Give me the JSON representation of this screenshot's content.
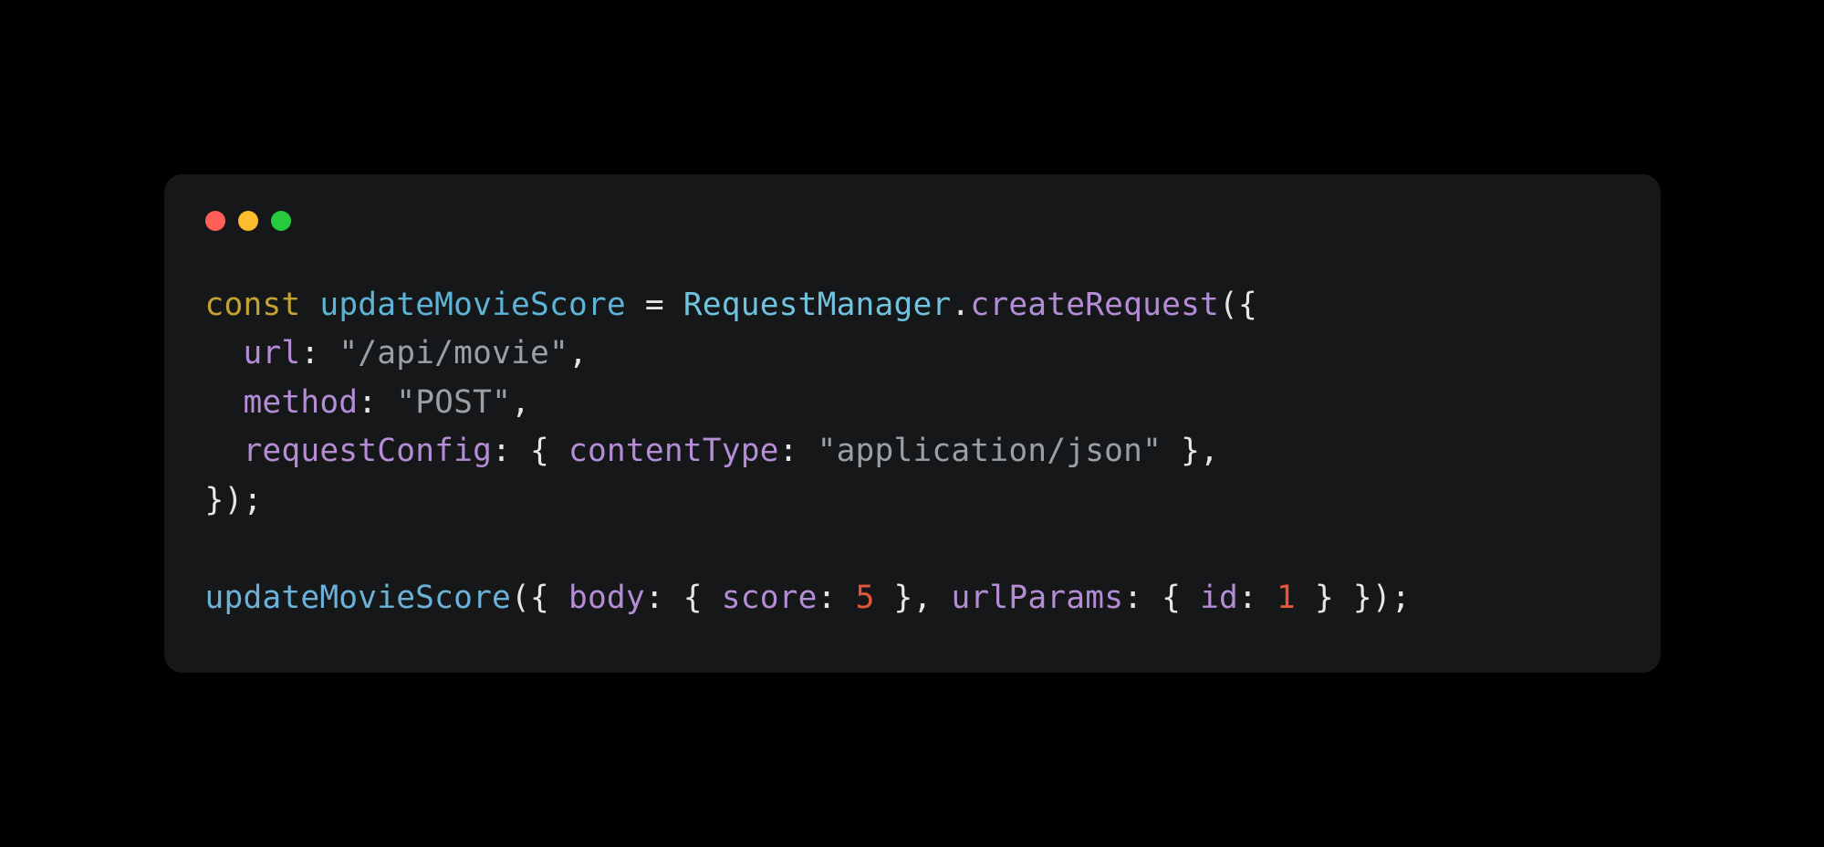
{
  "code": {
    "t_const": "const",
    "t_varName": "updateMovieScore",
    "t_eq": " = ",
    "t_class": "RequestManager",
    "t_dot": ".",
    "t_method": "createRequest",
    "t_open": "({",
    "t_url_key": "url",
    "t_colon1": ": ",
    "t_url_val": "\"/api/movie\"",
    "t_comma1": ",",
    "t_method_key": "method",
    "t_colon2": ": ",
    "t_method_val": "\"POST\"",
    "t_comma2": ",",
    "t_cfg_key": "requestConfig",
    "t_colon3": ": { ",
    "t_ct_key": "contentType",
    "t_colon4": ": ",
    "t_ct_val": "\"application/json\"",
    "t_close_cfg": " },",
    "t_close": "});",
    "t_callName": "updateMovieScore",
    "t_call_open": "({ ",
    "t_body_key": "body",
    "t_colon5": ": { ",
    "t_score_key": "score",
    "t_colon6": ": ",
    "t_score_val": "5",
    "t_close_body": " }, ",
    "t_params_key": "urlParams",
    "t_colon7": ": { ",
    "t_id_key": "id",
    "t_colon8": ": ",
    "t_id_val": "1",
    "t_close_call": " } });"
  }
}
